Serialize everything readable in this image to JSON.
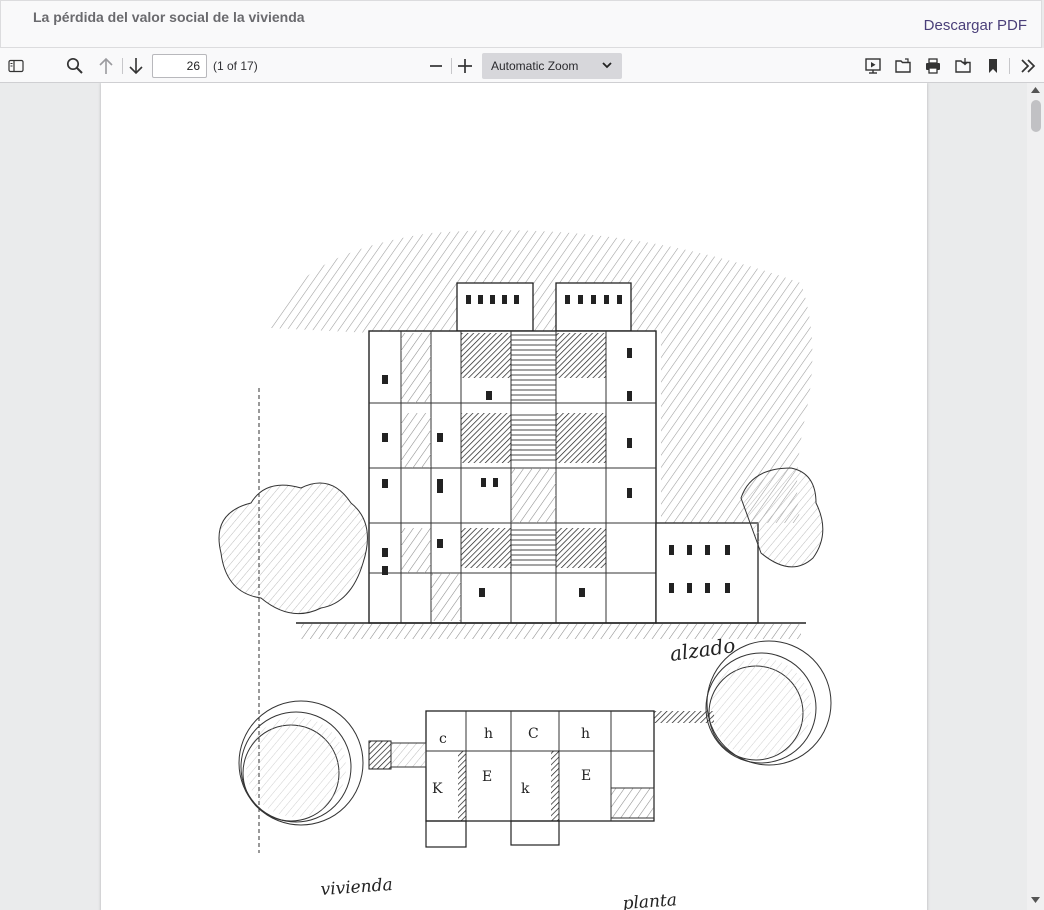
{
  "app": {
    "title": "La pérdida del valor social de la vivienda",
    "download_label": "Descargar PDF"
  },
  "toolbar": {
    "page_number": "26",
    "page_count": "(1 of 17)",
    "zoom_label": "Automatic Zoom",
    "icons": [
      "sidebar-toggle-icon",
      "search-icon",
      "arrow-up-icon",
      "arrow-down-icon",
      "zoom-out-icon",
      "zoom-in-icon",
      "presentation-icon",
      "open-file-icon",
      "print-icon",
      "save-icon",
      "bookmark-icon",
      "double-chevron-right-icon"
    ]
  },
  "document": {
    "sketch_labels": [
      "alzado",
      "vivienda",
      "planta"
    ]
  }
}
